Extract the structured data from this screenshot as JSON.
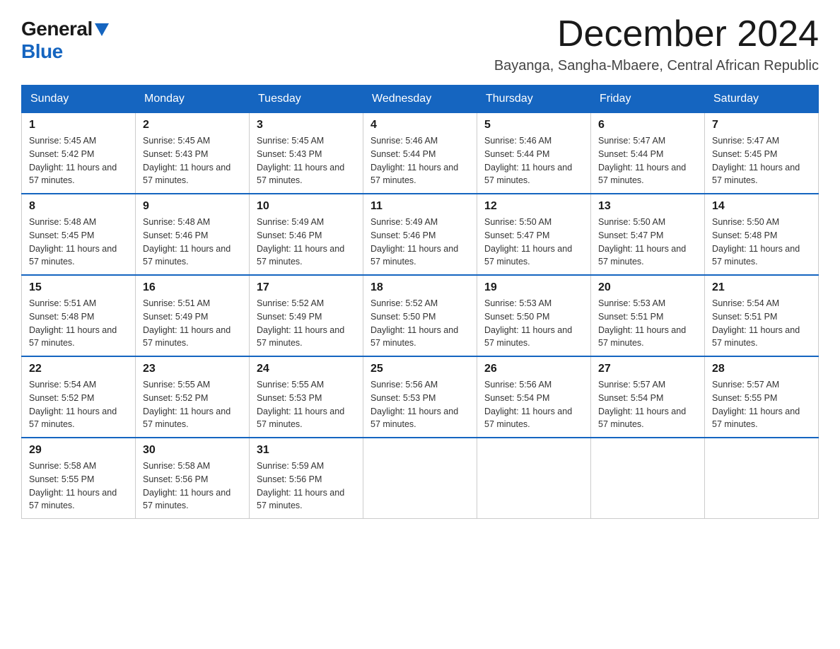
{
  "header": {
    "logo_general": "General",
    "logo_blue": "Blue",
    "month_title": "December 2024",
    "location": "Bayanga, Sangha-Mbaere, Central African Republic"
  },
  "days_of_week": [
    "Sunday",
    "Monday",
    "Tuesday",
    "Wednesday",
    "Thursday",
    "Friday",
    "Saturday"
  ],
  "weeks": [
    [
      {
        "day": "1",
        "sunrise": "5:45 AM",
        "sunset": "5:42 PM",
        "daylight": "11 hours and 57 minutes."
      },
      {
        "day": "2",
        "sunrise": "5:45 AM",
        "sunset": "5:43 PM",
        "daylight": "11 hours and 57 minutes."
      },
      {
        "day": "3",
        "sunrise": "5:45 AM",
        "sunset": "5:43 PM",
        "daylight": "11 hours and 57 minutes."
      },
      {
        "day": "4",
        "sunrise": "5:46 AM",
        "sunset": "5:44 PM",
        "daylight": "11 hours and 57 minutes."
      },
      {
        "day": "5",
        "sunrise": "5:46 AM",
        "sunset": "5:44 PM",
        "daylight": "11 hours and 57 minutes."
      },
      {
        "day": "6",
        "sunrise": "5:47 AM",
        "sunset": "5:44 PM",
        "daylight": "11 hours and 57 minutes."
      },
      {
        "day": "7",
        "sunrise": "5:47 AM",
        "sunset": "5:45 PM",
        "daylight": "11 hours and 57 minutes."
      }
    ],
    [
      {
        "day": "8",
        "sunrise": "5:48 AM",
        "sunset": "5:45 PM",
        "daylight": "11 hours and 57 minutes."
      },
      {
        "day": "9",
        "sunrise": "5:48 AM",
        "sunset": "5:46 PM",
        "daylight": "11 hours and 57 minutes."
      },
      {
        "day": "10",
        "sunrise": "5:49 AM",
        "sunset": "5:46 PM",
        "daylight": "11 hours and 57 minutes."
      },
      {
        "day": "11",
        "sunrise": "5:49 AM",
        "sunset": "5:46 PM",
        "daylight": "11 hours and 57 minutes."
      },
      {
        "day": "12",
        "sunrise": "5:50 AM",
        "sunset": "5:47 PM",
        "daylight": "11 hours and 57 minutes."
      },
      {
        "day": "13",
        "sunrise": "5:50 AM",
        "sunset": "5:47 PM",
        "daylight": "11 hours and 57 minutes."
      },
      {
        "day": "14",
        "sunrise": "5:50 AM",
        "sunset": "5:48 PM",
        "daylight": "11 hours and 57 minutes."
      }
    ],
    [
      {
        "day": "15",
        "sunrise": "5:51 AM",
        "sunset": "5:48 PM",
        "daylight": "11 hours and 57 minutes."
      },
      {
        "day": "16",
        "sunrise": "5:51 AM",
        "sunset": "5:49 PM",
        "daylight": "11 hours and 57 minutes."
      },
      {
        "day": "17",
        "sunrise": "5:52 AM",
        "sunset": "5:49 PM",
        "daylight": "11 hours and 57 minutes."
      },
      {
        "day": "18",
        "sunrise": "5:52 AM",
        "sunset": "5:50 PM",
        "daylight": "11 hours and 57 minutes."
      },
      {
        "day": "19",
        "sunrise": "5:53 AM",
        "sunset": "5:50 PM",
        "daylight": "11 hours and 57 minutes."
      },
      {
        "day": "20",
        "sunrise": "5:53 AM",
        "sunset": "5:51 PM",
        "daylight": "11 hours and 57 minutes."
      },
      {
        "day": "21",
        "sunrise": "5:54 AM",
        "sunset": "5:51 PM",
        "daylight": "11 hours and 57 minutes."
      }
    ],
    [
      {
        "day": "22",
        "sunrise": "5:54 AM",
        "sunset": "5:52 PM",
        "daylight": "11 hours and 57 minutes."
      },
      {
        "day": "23",
        "sunrise": "5:55 AM",
        "sunset": "5:52 PM",
        "daylight": "11 hours and 57 minutes."
      },
      {
        "day": "24",
        "sunrise": "5:55 AM",
        "sunset": "5:53 PM",
        "daylight": "11 hours and 57 minutes."
      },
      {
        "day": "25",
        "sunrise": "5:56 AM",
        "sunset": "5:53 PM",
        "daylight": "11 hours and 57 minutes."
      },
      {
        "day": "26",
        "sunrise": "5:56 AM",
        "sunset": "5:54 PM",
        "daylight": "11 hours and 57 minutes."
      },
      {
        "day": "27",
        "sunrise": "5:57 AM",
        "sunset": "5:54 PM",
        "daylight": "11 hours and 57 minutes."
      },
      {
        "day": "28",
        "sunrise": "5:57 AM",
        "sunset": "5:55 PM",
        "daylight": "11 hours and 57 minutes."
      }
    ],
    [
      {
        "day": "29",
        "sunrise": "5:58 AM",
        "sunset": "5:55 PM",
        "daylight": "11 hours and 57 minutes."
      },
      {
        "day": "30",
        "sunrise": "5:58 AM",
        "sunset": "5:56 PM",
        "daylight": "11 hours and 57 minutes."
      },
      {
        "day": "31",
        "sunrise": "5:59 AM",
        "sunset": "5:56 PM",
        "daylight": "11 hours and 57 minutes."
      },
      null,
      null,
      null,
      null
    ]
  ]
}
